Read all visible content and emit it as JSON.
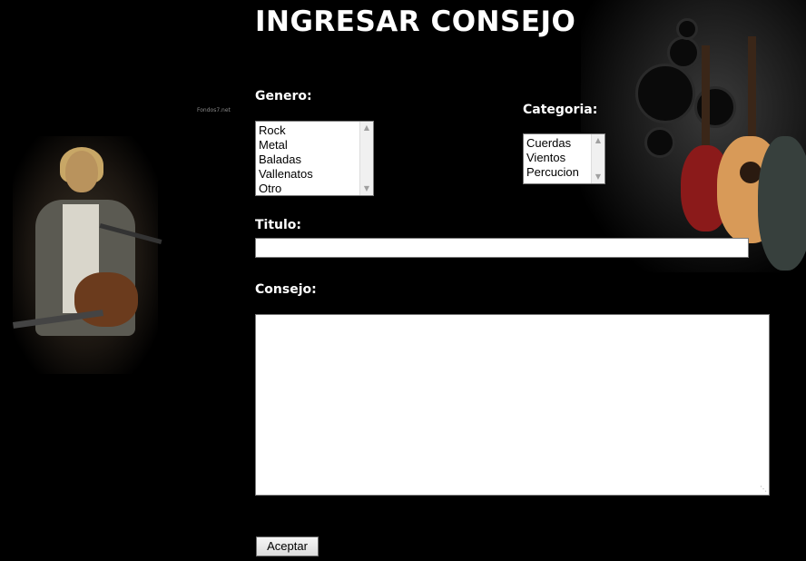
{
  "page": {
    "title": "INGRESAR CONSEJO",
    "watermark": "Fondos7.net"
  },
  "form": {
    "genero_label": "Genero:",
    "genero_options": [
      "Rock",
      "Metal",
      "Baladas",
      "Vallenatos",
      "Otro"
    ],
    "categoria_label": "Categoria:",
    "categoria_options": [
      "Cuerdas",
      "Vientos",
      "Percucion"
    ],
    "titulo_label": "Titulo:",
    "titulo_value": "",
    "consejo_label": "Consejo:",
    "consejo_value": "",
    "submit_label": "Aceptar"
  },
  "icons": {
    "scroll_up": "chevron-up-icon",
    "scroll_down": "chevron-down-icon",
    "resize_grip": "resize-grip-icon"
  },
  "colors": {
    "background": "#000000",
    "text": "#ffffff"
  }
}
